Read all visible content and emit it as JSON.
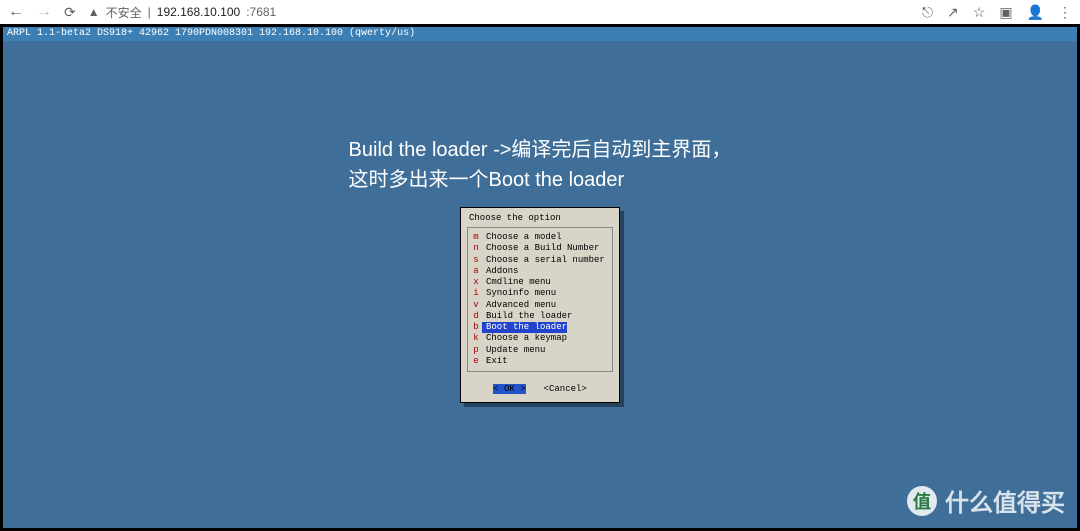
{
  "browser": {
    "insecure_label": "不安全",
    "url_host": "192.168.10.100",
    "url_port": ":7681"
  },
  "status": {
    "text": "ARPL 1.1-beta2 DS918+ 42962 1790PDN008301 192.168.10.100 (qwerty/us)"
  },
  "caption": {
    "line1": "Build the loader ->编译完后自动到主界面，",
    "line2": "这时多出来一个Boot the loader"
  },
  "dialog": {
    "title": "Choose the option",
    "ok": "OK",
    "cancel": "<Cancel>",
    "items": [
      {
        "key": "m",
        "label": "Choose a model",
        "selected": false
      },
      {
        "key": "n",
        "label": "Choose a Build Number",
        "selected": false
      },
      {
        "key": "s",
        "label": "Choose a serial number",
        "selected": false
      },
      {
        "key": "a",
        "label": "Addons",
        "selected": false
      },
      {
        "key": "x",
        "label": "Cmdline menu",
        "selected": false
      },
      {
        "key": "i",
        "label": "Synoinfo menu",
        "selected": false
      },
      {
        "key": "v",
        "label": "Advanced menu",
        "selected": false
      },
      {
        "key": "d",
        "label": "Build the loader",
        "selected": false
      },
      {
        "key": "b",
        "label": "Boot the loader",
        "selected": true
      },
      {
        "key": "k",
        "label": "Choose a keymap",
        "selected": false
      },
      {
        "key": "p",
        "label": "Update menu",
        "selected": false
      },
      {
        "key": "e",
        "label": "Exit",
        "selected": false
      }
    ]
  },
  "watermark": {
    "badge": "值",
    "text": "什么值得买"
  }
}
